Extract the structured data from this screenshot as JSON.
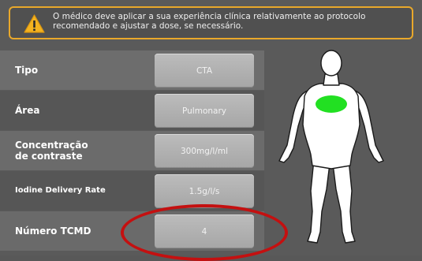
{
  "warning": {
    "icon": "warning-icon",
    "accent_color": "#e9a82b",
    "line1": "O médico deve aplicar a sua experiência clínica relativamente ao protocolo",
    "line2": "recomendado e ajustar a dose, se necessário."
  },
  "rows": [
    {
      "label": "Tipo",
      "value": "CTA"
    },
    {
      "label": "Área",
      "value": "Pulmonary"
    },
    {
      "label": "Concentração\nde contraste",
      "value": "300mg/l/ml"
    },
    {
      "label": "Iodine Delivery Rate",
      "value": "1.5g/l/s"
    },
    {
      "label": "Número TCMD",
      "value": "4"
    }
  ],
  "body_diagram": {
    "figure": "human-body-silhouette",
    "highlighted_region": "chest",
    "highlight_color": "#22e022",
    "highlight_ring_color": "#c41010"
  }
}
